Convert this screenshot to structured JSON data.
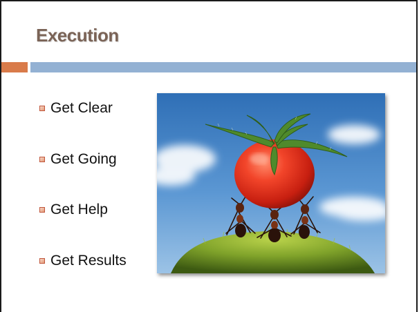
{
  "slide": {
    "title": "Execution",
    "accent_color": "#d97b4a",
    "bar_color": "#93b1d3",
    "title_color": "#7a6356"
  },
  "bullets": [
    "Get Clear",
    "Get Going",
    "Get Help",
    "Get Results"
  ],
  "bullet_icon": "square-bullet-icon",
  "photo": {
    "subject": "ants-carrying-tomato-image"
  }
}
